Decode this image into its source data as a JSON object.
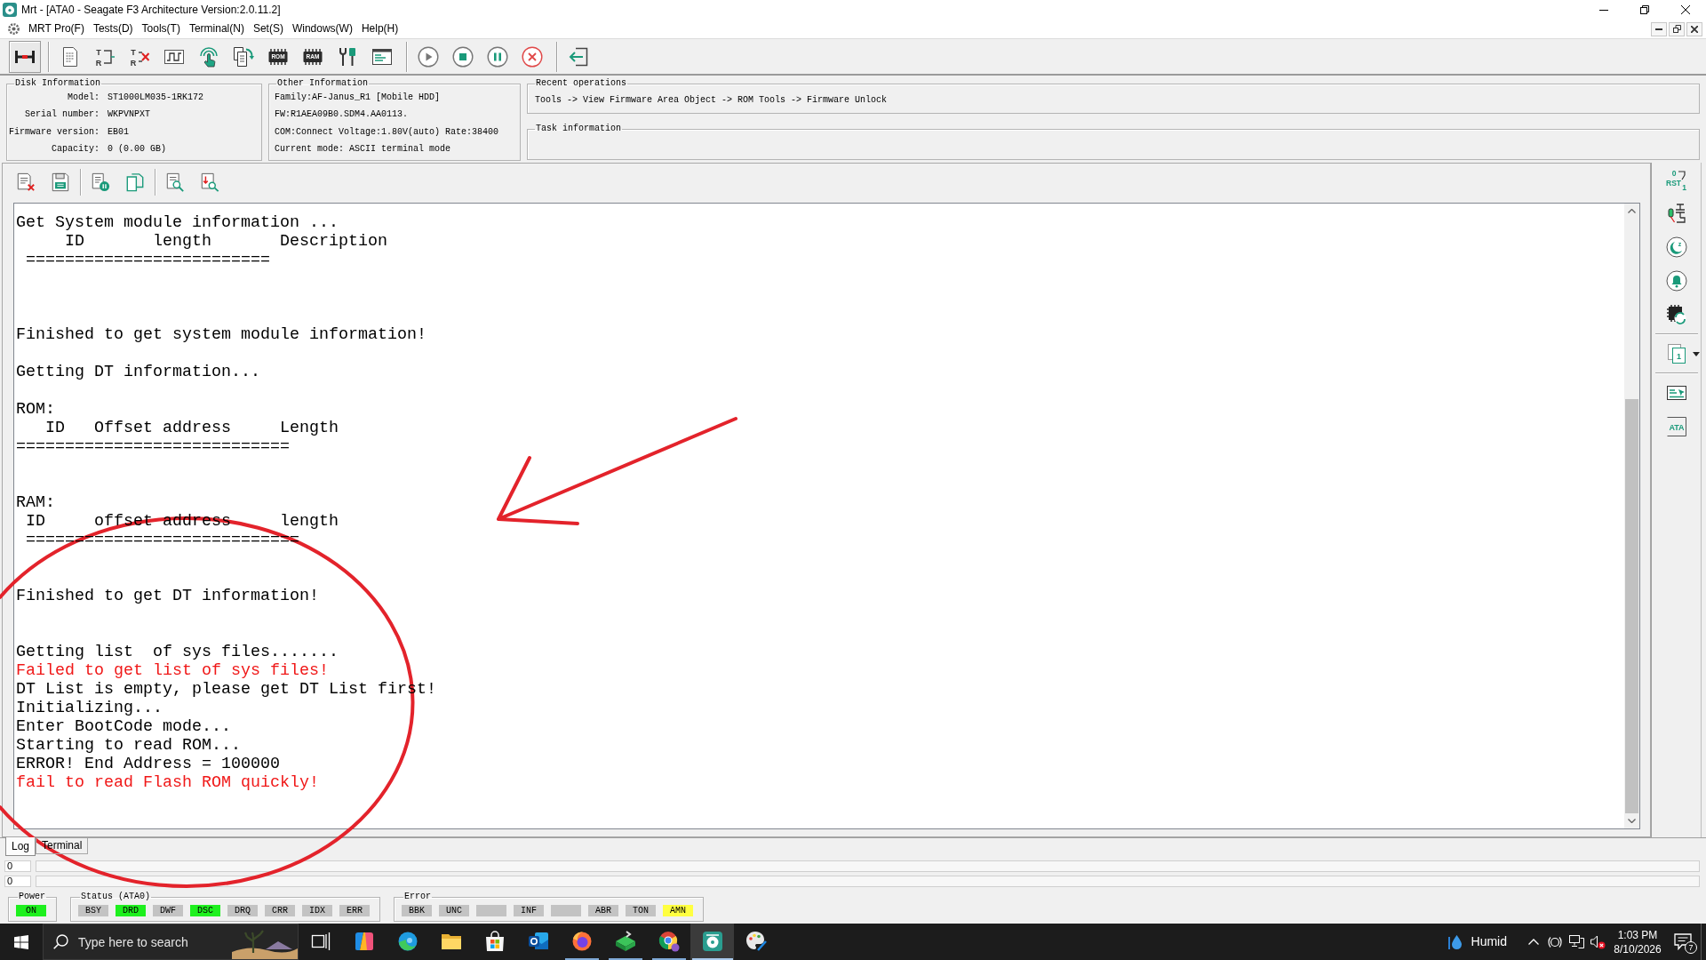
{
  "window": {
    "title": "Mrt - [ATA0 - Seagate F3 Architecture Version:2.0.11.2]"
  },
  "menu": [
    "MRT Pro(F)",
    "Tests(D)",
    "Tools(T)",
    "Terminal(N)",
    "Set(S)",
    "Windows(W)",
    "Help(H)"
  ],
  "toolbar": {
    "groups": [
      {
        "buttons": [
          {
            "kind": "link",
            "pressed": true
          }
        ]
      },
      {
        "buttons": [
          {
            "kind": "doc",
            "pressed": false
          },
          {
            "kind": "tr",
            "letters": [
              "T",
              "R"
            ],
            "pressed": false
          },
          {
            "kind": "tr-x",
            "letters": [
              "T",
              "R"
            ],
            "pressed": false
          },
          {
            "kind": "wave",
            "pressed": false
          },
          {
            "kind": "touch",
            "pressed": false
          },
          {
            "kind": "docs-cycle",
            "pressed": false
          },
          {
            "kind": "chip",
            "letters": [
              "ROM"
            ],
            "pressed": false
          },
          {
            "kind": "chip",
            "letters": [
              "RAM"
            ],
            "pressed": false
          },
          {
            "kind": "tools",
            "pressed": false
          },
          {
            "kind": "console",
            "pressed": false
          }
        ]
      },
      {
        "buttons": [
          {
            "kind": "play",
            "pressed": false
          },
          {
            "kind": "stop",
            "pressed": false
          },
          {
            "kind": "pause",
            "pressed": false
          },
          {
            "kind": "cancel",
            "pressed": false
          }
        ]
      },
      {
        "buttons": [
          {
            "kind": "exit",
            "pressed": false
          }
        ]
      }
    ]
  },
  "disk_information": {
    "title": "Disk Information",
    "fields": [
      {
        "label": "Model:",
        "value": "ST1000LM035-1RK172"
      },
      {
        "label": "Serial number:",
        "value": "WKPVNPXT"
      },
      {
        "label": "Firmware version:",
        "value": "EB01"
      },
      {
        "label": "Capacity:",
        "value": "0 (0.00 GB)"
      }
    ]
  },
  "other_information": {
    "title": "Other Information",
    "lines": [
      "Family:AF-Janus_R1 [Mobile HDD]",
      "FW:R1AEA09B0.SDM4.AA0113.",
      "COM:Connect Voltage:1.80V(auto) Rate:38400",
      "Current mode: ASCII terminal mode"
    ]
  },
  "recent_operations": {
    "title": "Recent operations",
    "text": "Tools -> View Firmware Area Object -> ROM Tools -> Firmware Unlock"
  },
  "task_information": {
    "title": "Task information"
  },
  "log_toolbar": {
    "groups": [
      {
        "buttons": [
          {
            "kind": "doc-x"
          },
          {
            "kind": "save"
          }
        ]
      },
      {
        "buttons": [
          {
            "kind": "doc-pause"
          },
          {
            "kind": "copy"
          }
        ]
      },
      {
        "buttons": [
          {
            "kind": "doc-search"
          },
          {
            "kind": "doc-down-search"
          }
        ]
      }
    ]
  },
  "log": {
    "lines": [
      {
        "kind": "text",
        "text": "Get System module information ..."
      },
      {
        "kind": "text",
        "text": "     ID       length       Description"
      },
      {
        "kind": "text",
        "text": " ========================="
      },
      {
        "kind": "blank"
      },
      {
        "kind": "blank"
      },
      {
        "kind": "blank"
      },
      {
        "kind": "text",
        "text": "Finished to get system module information!"
      },
      {
        "kind": "blank"
      },
      {
        "kind": "text",
        "text": "Getting DT information..."
      },
      {
        "kind": "blank"
      },
      {
        "kind": "text",
        "text": "ROM:"
      },
      {
        "kind": "text",
        "text": "   ID   Offset address     Length"
      },
      {
        "kind": "text",
        "text": "============================"
      },
      {
        "kind": "blank"
      },
      {
        "kind": "blank"
      },
      {
        "kind": "text",
        "text": "RAM:"
      },
      {
        "kind": "text",
        "text": " ID     offset address     length"
      },
      {
        "kind": "text",
        "text": " ============================"
      },
      {
        "kind": "blank"
      },
      {
        "kind": "blank"
      },
      {
        "kind": "text",
        "text": "Finished to get DT information!"
      },
      {
        "kind": "blank"
      },
      {
        "kind": "blank"
      },
      {
        "kind": "text",
        "text": "Getting list  of sys files......."
      },
      {
        "kind": "error",
        "text": "Failed to get list of sys files!"
      },
      {
        "kind": "text",
        "text": "DT List is empty, please get DT List first!"
      },
      {
        "kind": "text",
        "text": "Initializing..."
      },
      {
        "kind": "text",
        "text": "Enter BootCode mode..."
      },
      {
        "kind": "text",
        "text": "Starting to read ROM..."
      },
      {
        "kind": "text",
        "text": "ERROR! End Address = 100000"
      },
      {
        "kind": "error",
        "text": "fail to read Flash ROM quickly!"
      }
    ]
  },
  "side_toolbar": {
    "groups": [
      {
        "buttons": [
          {
            "kind": "rst",
            "letters": [
              "0",
              "RST",
              "1"
            ]
          },
          {
            "kind": "capacitor"
          },
          {
            "kind": "sleep",
            "letters": [
              "z"
            ]
          },
          {
            "kind": "bell"
          },
          {
            "kind": "chip-cycle"
          }
        ]
      },
      {
        "buttons": [
          {
            "kind": "page-menu",
            "letters": [
              "1"
            ]
          }
        ]
      },
      {
        "buttons": [
          {
            "kind": "screen-arrow"
          },
          {
            "kind": "ata",
            "letters": [
              "ATA"
            ]
          }
        ]
      }
    ]
  },
  "tabs": [
    {
      "label": "Log",
      "selected": true
    },
    {
      "label": "Terminal",
      "selected": false
    }
  ],
  "progress": [
    {
      "value": "0",
      "level": 0
    },
    {
      "value": "0",
      "level": 0
    }
  ],
  "indicator_groups": [
    {
      "kind": "power",
      "title": "Power",
      "items": [
        {
          "label": "ON",
          "on": true
        }
      ]
    },
    {
      "kind": "status",
      "title": "Status (ATA0)",
      "items": [
        {
          "label": "BSY",
          "on": false
        },
        {
          "label": "DRD",
          "on": true
        },
        {
          "label": "DWF",
          "on": false
        },
        {
          "label": "DSC",
          "on": true
        },
        {
          "label": "DRQ",
          "on": false
        },
        {
          "label": "CRR",
          "on": false
        },
        {
          "label": "IDX",
          "on": false
        },
        {
          "label": "ERR",
          "on": false
        }
      ]
    },
    {
      "kind": "error",
      "title": "Error",
      "items": [
        {
          "label": "BBK",
          "on": false
        },
        {
          "label": "UNC",
          "on": false
        },
        {
          "on": false
        },
        {
          "label": "INF",
          "on": false
        },
        {
          "on": false
        },
        {
          "label": "ABR",
          "on": false
        },
        {
          "label": "TON",
          "on": false
        },
        {
          "label": "AMN",
          "on": true
        }
      ]
    }
  ],
  "annotations": {
    "ellipse": true,
    "arrow": true
  },
  "taskbar": {
    "search": {
      "placeholder": "Type here to search"
    },
    "apps": [
      {
        "kind": "task-view",
        "running": false,
        "selected": false
      },
      {
        "kind": "ribbon",
        "running": false,
        "selected": false
      },
      {
        "kind": "swirl",
        "running": false,
        "selected": false
      },
      {
        "kind": "folder",
        "running": false,
        "selected": false
      },
      {
        "kind": "store",
        "running": false,
        "selected": false
      },
      {
        "kind": "mail",
        "running": false,
        "selected": false
      },
      {
        "kind": "fox",
        "running": true,
        "selected": false
      },
      {
        "kind": "drive",
        "running": true,
        "selected": false
      },
      {
        "kind": "ring",
        "running": true,
        "selected": false
      },
      {
        "kind": "disk-app",
        "running": true,
        "selected": true
      },
      {
        "kind": "palette",
        "running": false,
        "selected": false
      }
    ],
    "weather": {
      "text": "Humid"
    },
    "tray": [
      {
        "kind": "chevron"
      },
      {
        "kind": "camera"
      },
      {
        "kind": "network"
      },
      {
        "kind": "speaker-muted"
      }
    ],
    "clock": {
      "time": "1:03 PM",
      "date": "8/10/2026"
    },
    "notifications": {
      "count": "7"
    }
  }
}
